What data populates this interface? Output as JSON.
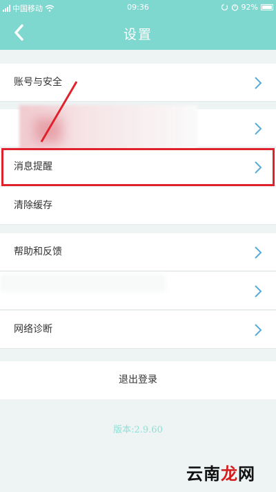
{
  "status_bar": {
    "carrier": "中国移动",
    "time": "09:36",
    "battery": "92%"
  },
  "header": {
    "title": "设置"
  },
  "settings": [
    {
      "label": "账号与安全"
    },
    {
      "label": ""
    },
    {
      "label": "消息提醒"
    },
    {
      "label": "清除缓存"
    },
    {
      "label": "帮助和反馈"
    },
    {
      "label": ""
    },
    {
      "label": "网络诊断"
    }
  ],
  "footer": {
    "logout_label": "退出登录",
    "version": "版本:2.9.60"
  },
  "watermark": {
    "text_main": "云南",
    "text_accent": "龙",
    "text_tail": "网"
  },
  "colors": {
    "accent": "#7fd8cf",
    "highlight": "#e0212b",
    "chevron": "#5aa9d6"
  },
  "icons": {
    "back": "chevron-left-icon",
    "row_arrow": "chevron-right-icon"
  }
}
